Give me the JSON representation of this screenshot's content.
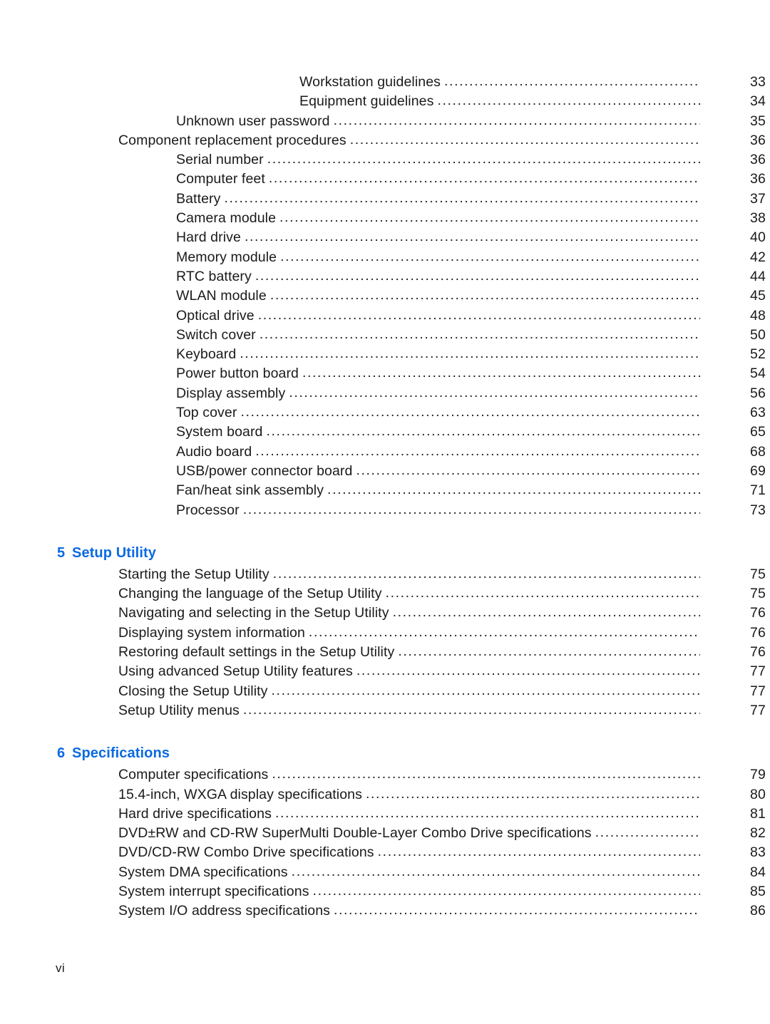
{
  "document": {
    "footer_page_label": "vi"
  },
  "toc": {
    "leader_dots": "..............................................................................................................................................................................",
    "sections": [
      {
        "type": "entries",
        "entries": [
          {
            "label": "Workstation guidelines",
            "page": "33",
            "level": 3
          },
          {
            "label": "Equipment guidelines",
            "page": "34",
            "level": 3
          },
          {
            "label": "Unknown user password",
            "page": "35",
            "level": 2
          },
          {
            "label": "Component replacement procedures",
            "page": "36",
            "level": 1
          },
          {
            "label": "Serial number",
            "page": "36",
            "level": 2
          },
          {
            "label": "Computer feet",
            "page": "36",
            "level": 2
          },
          {
            "label": "Battery",
            "page": "37",
            "level": 2
          },
          {
            "label": "Camera module",
            "page": "38",
            "level": 2
          },
          {
            "label": "Hard drive",
            "page": "40",
            "level": 2
          },
          {
            "label": "Memory module",
            "page": "42",
            "level": 2
          },
          {
            "label": "RTC battery",
            "page": "44",
            "level": 2
          },
          {
            "label": "WLAN module",
            "page": "45",
            "level": 2
          },
          {
            "label": "Optical drive",
            "page": "48",
            "level": 2
          },
          {
            "label": "Switch cover",
            "page": "50",
            "level": 2
          },
          {
            "label": "Keyboard",
            "page": "52",
            "level": 2
          },
          {
            "label": "Power button board",
            "page": "54",
            "level": 2
          },
          {
            "label": "Display assembly",
            "page": "56",
            "level": 2
          },
          {
            "label": "Top cover",
            "page": "63",
            "level": 2
          },
          {
            "label": "System board",
            "page": "65",
            "level": 2
          },
          {
            "label": "Audio board",
            "page": "68",
            "level": 2
          },
          {
            "label": "USB/power connector board",
            "page": "69",
            "level": 2
          },
          {
            "label": "Fan/heat sink assembly",
            "page": "71",
            "level": 2
          },
          {
            "label": "Processor",
            "page": "73",
            "level": 2
          }
        ]
      },
      {
        "type": "chapter",
        "number": "5",
        "title": "Setup Utility",
        "entries": [
          {
            "label": "Starting the Setup Utility",
            "page": "75",
            "level": 1
          },
          {
            "label": "Changing the language of the Setup Utility",
            "page": "75",
            "level": 1
          },
          {
            "label": "Navigating and selecting in the Setup Utility",
            "page": "76",
            "level": 1
          },
          {
            "label": "Displaying system information",
            "page": "76",
            "level": 1
          },
          {
            "label": "Restoring default settings in the Setup Utility",
            "page": "76",
            "level": 1
          },
          {
            "label": "Using advanced Setup Utility features",
            "page": "77",
            "level": 1
          },
          {
            "label": "Closing the Setup Utility",
            "page": "77",
            "level": 1
          },
          {
            "label": "Setup Utility menus",
            "page": "77",
            "level": 1
          }
        ]
      },
      {
        "type": "chapter",
        "number": "6",
        "title": "Specifications",
        "entries": [
          {
            "label": "Computer specifications",
            "page": "79",
            "level": 1
          },
          {
            "label": "15.4-inch, WXGA display specifications",
            "page": "80",
            "level": 1
          },
          {
            "label": "Hard drive specifications",
            "page": "81",
            "level": 1
          },
          {
            "label": "DVD±RW and CD-RW SuperMulti Double-Layer Combo Drive specifications",
            "page": "82",
            "level": 1
          },
          {
            "label": "DVD/CD-RW Combo Drive specifications",
            "page": "83",
            "level": 1
          },
          {
            "label": "System DMA specifications",
            "page": "84",
            "level": 1
          },
          {
            "label": "System interrupt specifications",
            "page": "85",
            "level": 1
          },
          {
            "label": "System I/O address specifications",
            "page": "86",
            "level": 1
          }
        ]
      }
    ]
  },
  "colors": {
    "heading_blue": "#0a6ae2",
    "body_text": "#1a1a1a",
    "page_background": "#ffffff"
  }
}
